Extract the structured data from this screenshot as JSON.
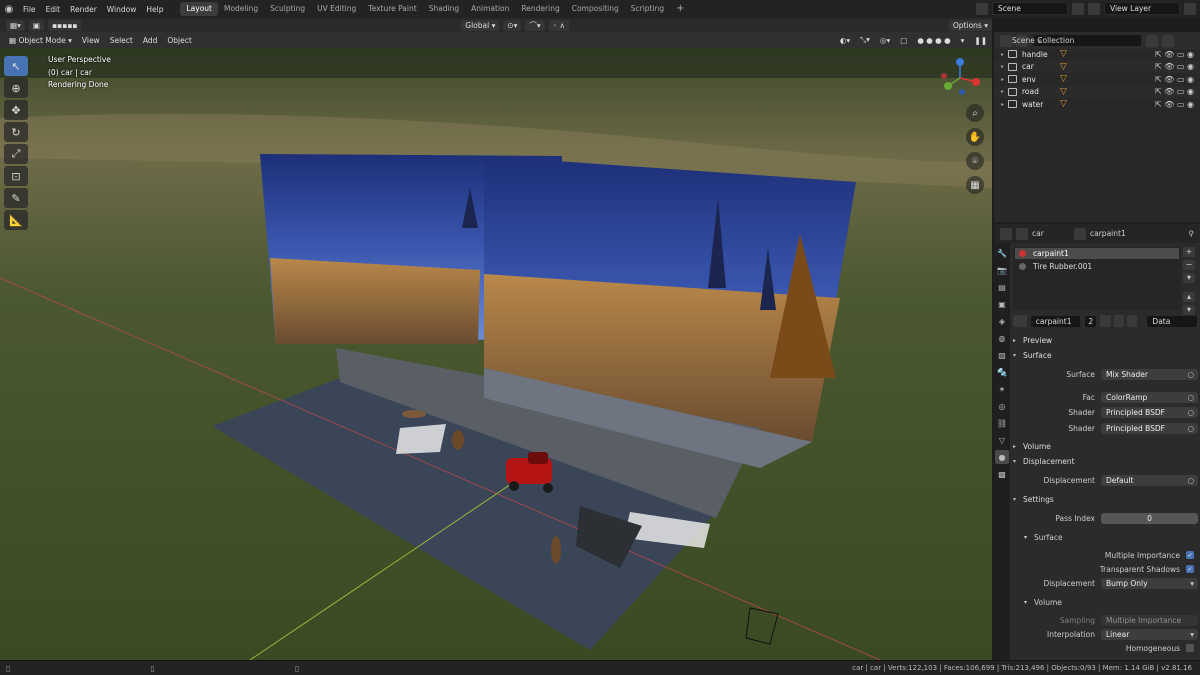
{
  "menu": [
    "File",
    "Edit",
    "Render",
    "Window",
    "Help"
  ],
  "workspaces": [
    "Layout",
    "Modeling",
    "Sculpting",
    "UV Editing",
    "Texture Paint",
    "Shading",
    "Animation",
    "Rendering",
    "Compositing",
    "Scripting"
  ],
  "active_workspace": "Layout",
  "scene_field": "Scene",
  "view_layer_field": "View Layer",
  "toolbar": {
    "transform_orientation": "Global",
    "options_label": "Options"
  },
  "header": {
    "mode": "Object Mode",
    "view": "View",
    "select": "Select",
    "add": "Add",
    "object": "Object"
  },
  "viewport_overlay": {
    "line1": "User Perspective",
    "line2": "(0) car | car",
    "line3": "Rendering Done"
  },
  "outliner": {
    "title": "Scene Collection",
    "items": [
      {
        "name": "handle"
      },
      {
        "name": "car"
      },
      {
        "name": "env"
      },
      {
        "name": "road"
      },
      {
        "name": "water"
      }
    ]
  },
  "properties": {
    "object_name": "car",
    "material_name": "carpaint1",
    "slots": [
      "carpaint1",
      "Tire Rubber.001"
    ],
    "mat_field": "carpaint1",
    "users": "2",
    "link": "Data",
    "preview": "Preview",
    "surface_section": "Surface",
    "surface_label": "Surface",
    "surface_value": "Mix Shader",
    "fac_label": "Fac",
    "fac_value": "ColorRamp",
    "shader1_label": "Shader",
    "shader1_value": "Principled BSDF",
    "shader2_label": "Shader",
    "shader2_value": "Principled BSDF",
    "volume_section": "Volume",
    "displacement_section": "Displacement",
    "displacement_label": "Displacement",
    "displacement_value": "Default",
    "settings_section": "Settings",
    "pass_index_label": "Pass Index",
    "pass_index_value": "0",
    "surface_sub": "Surface",
    "multiple_importance": "Multiple Importance",
    "transparent_shadows": "Transparent Shadows",
    "disp_method_label": "Displacement",
    "disp_method_value": "Bump Only",
    "volume_sub": "Volume",
    "sampling_label": "Sampling",
    "sampling_value": "Multiple Importance",
    "interpolation_label": "Interpolation",
    "interpolation_value": "Linear",
    "homogeneous": "Homogeneous"
  },
  "status": "car | car | Verts:122,103 | Faces:106,699 | Tris:213,496 | Objects:0/93 | Mem: 1.14 GiB | v2.81.16"
}
